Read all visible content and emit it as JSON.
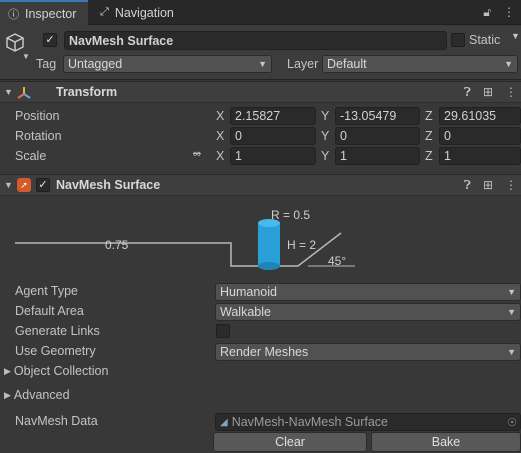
{
  "tabs": [
    {
      "label": "Inspector",
      "icon": "info-icon"
    },
    {
      "label": "Navigation",
      "icon": "navigation-icon"
    }
  ],
  "header": {
    "object_name": "NavMesh Surface",
    "static_label": "Static",
    "tag_label": "Tag",
    "tag_value": "Untagged",
    "layer_label": "Layer",
    "layer_value": "Default"
  },
  "transform": {
    "title": "Transform",
    "position": {
      "label": "Position",
      "x": "2.15827",
      "y": "-13.05479",
      "z": "29.61035"
    },
    "rotation": {
      "label": "Rotation",
      "x": "0",
      "y": "0",
      "z": "0"
    },
    "scale": {
      "label": "Scale",
      "x": "1",
      "y": "1",
      "z": "1"
    },
    "axis_x": "X",
    "axis_y": "Y",
    "axis_z": "Z"
  },
  "navmesh": {
    "title": "NavMesh Surface",
    "diagram": {
      "radius": "R = 0.5",
      "height": "H = 2",
      "step": "0.75",
      "slope": "45°"
    },
    "agent_type_label": "Agent Type",
    "agent_type_value": "Humanoid",
    "default_area_label": "Default Area",
    "default_area_value": "Walkable",
    "generate_links_label": "Generate Links",
    "use_geometry_label": "Use Geometry",
    "use_geometry_value": "Render Meshes",
    "object_collection_label": "Object Collection",
    "advanced_label": "Advanced",
    "navmesh_data_label": "NavMesh Data",
    "navmesh_data_value": "NavMesh-NavMesh Surface",
    "clear_label": "Clear",
    "bake_label": "Bake"
  },
  "colors": {
    "accent": "#3a79bb",
    "capsule": "#29a0d8",
    "background": "#383838"
  }
}
